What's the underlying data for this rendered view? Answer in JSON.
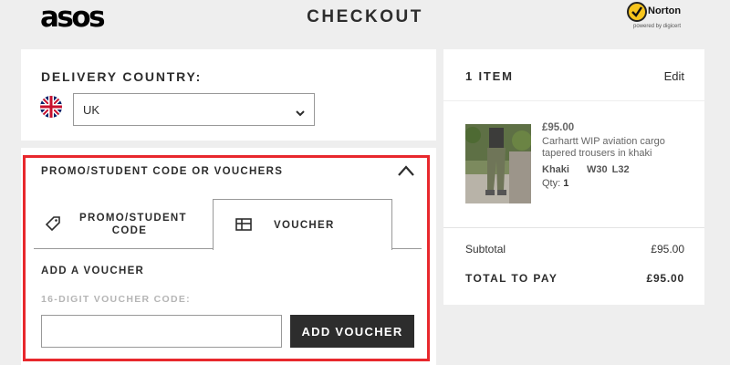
{
  "header": {
    "logo": "asos",
    "title": "CHECKOUT",
    "norton": {
      "name": "Norton",
      "sub": "powered by digicert"
    }
  },
  "delivery": {
    "label": "DELIVERY COUNTRY:",
    "country": "UK",
    "flag_icon": "uk-flag-icon"
  },
  "promo": {
    "heading": "PROMO/STUDENT CODE OR VOUCHERS",
    "tabs": [
      {
        "label": "PROMO/STUDENT CODE",
        "icon": "tag-icon"
      },
      {
        "label": "VOUCHER",
        "icon": "voucher-card-icon",
        "active": true
      }
    ],
    "add_voucher_heading": "ADD A VOUCHER",
    "voucher_code_label": "16-DIGIT VOUCHER CODE:",
    "voucher_code_value": "",
    "add_voucher_button": "ADD VOUCHER",
    "highlight_color": "#e8282d"
  },
  "summary": {
    "items_count": "1 ITEM",
    "edit": "Edit",
    "product": {
      "price": "£95.00",
      "name": "Carhartt WIP aviation cargo tapered trousers in khaki",
      "colour": "Khaki",
      "size": "W30 L32",
      "qty_label": "Qty:",
      "qty": "1"
    },
    "subtotal_label": "Subtotal",
    "subtotal_value": "£95.00",
    "total_label": "TOTAL TO PAY",
    "total_value": "£95.00"
  },
  "colors": {
    "background": "#eeeeee",
    "button": "#2d2d2d",
    "text": "#2d2d2d"
  }
}
